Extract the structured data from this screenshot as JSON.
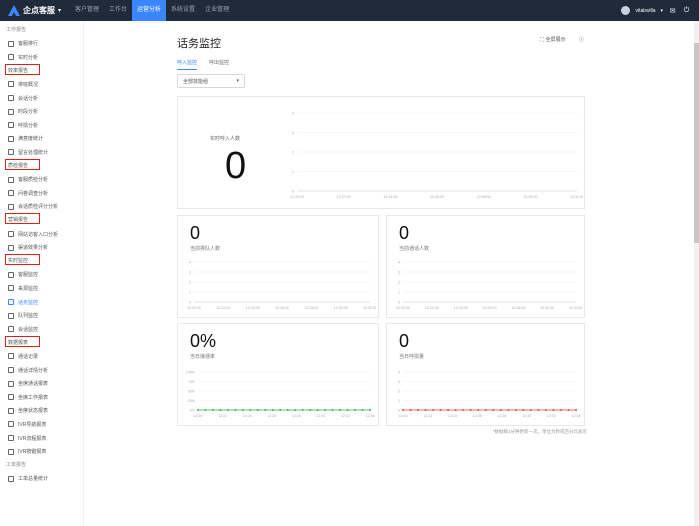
{
  "topbar": {
    "logo": "企点客服",
    "nav": [
      "客户管理",
      "工作台",
      "运营分析",
      "系统设置",
      "企业管理"
    ],
    "active_nav": 2,
    "username": "vitalsvilla"
  },
  "sidebar": {
    "entries": [
      {
        "kind": "group",
        "label": "工作报告",
        "highlight": false
      },
      {
        "kind": "item",
        "label": "客服排行",
        "icon": "report-icon"
      },
      {
        "kind": "item",
        "label": "实时分析",
        "icon": "chart-icon"
      },
      {
        "kind": "group",
        "label": "效率报告",
        "highlight": true
      },
      {
        "kind": "item",
        "label": "排班概况",
        "icon": "calendar-icon"
      },
      {
        "kind": "item",
        "label": "会话分析",
        "icon": "chat-icon"
      },
      {
        "kind": "item",
        "label": "时段分析",
        "icon": "clock-icon"
      },
      {
        "kind": "item",
        "label": "呼损分析",
        "icon": "phone-icon"
      },
      {
        "kind": "item",
        "label": "满意度统计",
        "icon": "star-icon"
      },
      {
        "kind": "item",
        "label": "留言处理统计",
        "icon": "message-icon"
      },
      {
        "kind": "group",
        "label": "质检报告",
        "highlight": true
      },
      {
        "kind": "item",
        "label": "客服质检分析",
        "icon": "check-icon"
      },
      {
        "kind": "item",
        "label": "问卷调查分析",
        "icon": "survey-icon"
      },
      {
        "kind": "item",
        "label": "会话质检评分分析",
        "icon": "score-icon"
      },
      {
        "kind": "group",
        "label": "营销报告",
        "highlight": true
      },
      {
        "kind": "item",
        "label": "网站访客入口分析",
        "icon": "globe-icon"
      },
      {
        "kind": "item",
        "label": "渠道效果分析",
        "icon": "channel-icon"
      },
      {
        "kind": "group",
        "label": "实时监控",
        "highlight": true
      },
      {
        "kind": "item",
        "label": "客服监控",
        "icon": "monitor-icon"
      },
      {
        "kind": "item",
        "label": "来源监控",
        "icon": "source-icon"
      },
      {
        "kind": "item",
        "label": "话务监控",
        "icon": "headset-icon",
        "active": true
      },
      {
        "kind": "item",
        "label": "队列监控",
        "icon": "queue-icon"
      },
      {
        "kind": "item",
        "label": "会话监控",
        "icon": "session-icon"
      },
      {
        "kind": "group",
        "label": "数据报表",
        "highlight": true
      },
      {
        "kind": "item",
        "label": "通话记录",
        "icon": "record-icon"
      },
      {
        "kind": "item",
        "label": "通话详情分析",
        "icon": "detail-icon"
      },
      {
        "kind": "item",
        "label": "坐席通话报表",
        "icon": "seat-icon"
      },
      {
        "kind": "item",
        "label": "坐席工作报表",
        "icon": "work-icon"
      },
      {
        "kind": "item",
        "label": "坐席状态报表",
        "icon": "status-icon"
      },
      {
        "kind": "item",
        "label": "IVR导航报表",
        "icon": "ivr-icon"
      },
      {
        "kind": "item",
        "label": "IVR流程报表",
        "icon": "flow-icon"
      },
      {
        "kind": "item",
        "label": "IVR按键报表",
        "icon": "key-icon"
      },
      {
        "kind": "group",
        "label": "工单报告",
        "highlight": false
      },
      {
        "kind": "item",
        "label": "工单总量统计",
        "icon": "ticket-icon"
      }
    ]
  },
  "main": {
    "title": "话务监控",
    "fullscreen_label": "全屏展示",
    "tabs": [
      "呼入监控",
      "呼出监控"
    ],
    "active_tab": 0,
    "select_value": "全部技能组",
    "footnote": "*数据每1分钟更新一次，单位为秒或百分比表示"
  },
  "cards": {
    "big": {
      "label": "实时呼入人数",
      "value": "0"
    },
    "c1": {
      "label": "当前排队人数",
      "value": "0"
    },
    "c2": {
      "label": "当前通话人数",
      "value": "0"
    },
    "c3": {
      "label": "当日接通率",
      "value": "0%"
    },
    "c4": {
      "label": "当日呼损量",
      "value": "0"
    }
  },
  "colors": {
    "accent": "#3a86ff",
    "green": "#37b24d",
    "red": "#f03e3e",
    "topbar": "#1f2a3a"
  },
  "chart_data": [
    {
      "type": "line",
      "title": "实时呼入人数",
      "x": [
        "12:20:00",
        "12:22:00",
        "12:24:00",
        "12:26:00",
        "12:28:00",
        "12:30:00",
        "12:32:00"
      ],
      "series": [
        {
          "values": [
            0,
            0,
            0,
            0,
            0,
            0,
            0
          ]
        }
      ],
      "yticks": [
        "4",
        "3",
        "2",
        "1",
        "0"
      ]
    },
    {
      "type": "line",
      "title": "当前排队人数",
      "x": [
        "12:20:00",
        "12:22:00",
        "12:24:00",
        "12:26:00",
        "12:28:00",
        "12:30:00",
        "12:32:00"
      ],
      "series": [
        {
          "values": [
            0,
            0,
            0,
            0,
            0,
            0,
            0
          ]
        }
      ],
      "yticks": [
        "4",
        "3",
        "2",
        "1",
        "0"
      ]
    },
    {
      "type": "line",
      "title": "当前通话人数",
      "x": [
        "12:20:00",
        "12:22:00",
        "12:24:00",
        "12:26:00",
        "12:28:00",
        "12:30:00",
        "12:32:00"
      ],
      "series": [
        {
          "values": [
            0,
            0,
            0,
            0,
            0,
            0,
            0
          ]
        }
      ],
      "yticks": [
        "4",
        "3",
        "2",
        "1",
        "0"
      ]
    },
    {
      "type": "line",
      "title": "当日接通率",
      "x": [
        "12:20",
        "12:22",
        "12:24",
        "12:26",
        "12:28",
        "12:30",
        "12:32",
        "12:34"
      ],
      "series": [
        {
          "values": [
            0,
            0,
            0,
            0,
            0,
            0,
            0,
            0,
            0,
            0,
            0,
            0,
            0,
            0,
            0,
            0,
            0,
            0,
            0,
            0,
            0,
            0,
            0,
            0
          ]
        }
      ],
      "yticks": [
        "100%",
        "75%",
        "50%",
        "25%",
        "0%"
      ],
      "marker_color": "#37b24d"
    },
    {
      "type": "line",
      "title": "当日呼损量",
      "x": [
        "12:20",
        "12:22",
        "12:24",
        "12:26",
        "12:28",
        "12:30",
        "12:32",
        "12:34"
      ],
      "series": [
        {
          "values": [
            0,
            0,
            0,
            0,
            0,
            0,
            0,
            0,
            0,
            0,
            0,
            0,
            0,
            0,
            0,
            0,
            0,
            0,
            0,
            0,
            0,
            0,
            0,
            0
          ]
        }
      ],
      "yticks": [
        "4",
        "3",
        "2",
        "1",
        "0"
      ],
      "marker_color": "#f03e3e"
    }
  ]
}
